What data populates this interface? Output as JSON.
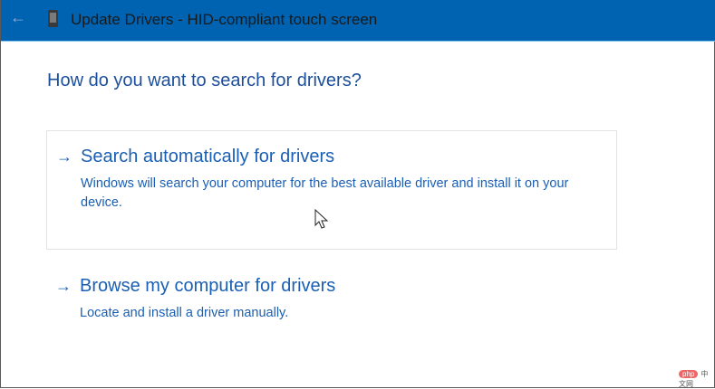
{
  "window": {
    "title": "Update Drivers - HID-compliant touch screen",
    "back_icon": "back-arrow-icon",
    "device_icon": "device-icon"
  },
  "heading": "How do you want to search for drivers?",
  "options": [
    {
      "arrow": "→",
      "title": "Search automatically for drivers",
      "description": "Windows will search your computer for the best available driver and install it on your device."
    },
    {
      "arrow": "→",
      "title": "Browse my computer for drivers",
      "description": "Locate and install a driver manually."
    }
  ],
  "watermark": {
    "badge": "php",
    "text": "中文网"
  },
  "colors": {
    "titlebar": "#0063b1",
    "link": "#1a5fb4"
  }
}
